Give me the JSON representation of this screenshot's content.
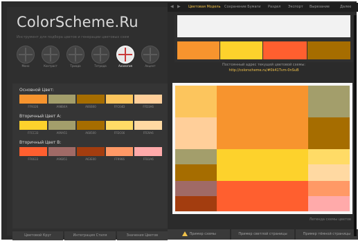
{
  "app": {
    "logo": "ColorScheme.Ru",
    "tagline": "Инструмент для подбора цветов и генерации цветовых схем"
  },
  "schemes": [
    {
      "label": "Моно",
      "active": false
    },
    {
      "label": "Контраст",
      "active": false
    },
    {
      "label": "Триада",
      "active": false
    },
    {
      "label": "Тетрада",
      "active": false
    },
    {
      "label": "Аналогия",
      "active": true
    },
    {
      "label": "Акцент",
      "active": false
    }
  ],
  "palette": {
    "primary_title": "Основной Цвет:",
    "secondary_a_title": "Вторичный Цвет А:",
    "secondary_b_title": "Вторичный Цвет В:",
    "primary_colors": [
      "#F7942E",
      "#A39E6B",
      "#A66D00",
      "#FCC55D",
      "#FFCF9A"
    ],
    "secondary_a_colors": [
      "#FDD22C",
      "#A39E6B",
      "#A66D00",
      "#FFDB66",
      "#FFD9A2"
    ],
    "secondary_b_colors": [
      "#FF5F2F",
      "#A06A66",
      "#A33D0F",
      "#FF9966",
      "#FFAAAA"
    ],
    "primary_codes": [
      "FF9326",
      "A98B4A",
      "A66B00",
      "FFC64D",
      "FFD3A6"
    ],
    "secondary_a_codes": [
      "FFCC33",
      "A99A51",
      "A68500",
      "FFDC66",
      "FFE9A6"
    ],
    "secondary_b_codes": [
      "FF6633",
      "A96B51",
      "A63E00",
      "FF9966",
      "FFB3A6"
    ]
  },
  "tabs_bottom_left": [
    "Цветовой Круг",
    "Интеграция Стиля",
    "Значения Цветов"
  ],
  "nav": {
    "items": [
      "Цветовая Модель",
      "Сохранение Бумаги",
      "Раздел",
      "Экспорт",
      "Вырезание",
      "Далее"
    ],
    "active_index": 0
  },
  "preview": {
    "top_swatches": [
      "#F7942E",
      "#FDD22C",
      "#FF5F2F",
      "#A66D00"
    ],
    "link_text": "Постоянный адрес текущей цветовой схемы:",
    "link_url": "http://colorscheme.ru/#0k41Tvm-0nSuB",
    "legend": "Легенда схемы цветов"
  },
  "tabs_bottom_right": [
    "Пример схемы",
    "Пример светлой страницы",
    "Пример тёмной страницы"
  ],
  "colors": {
    "frame": "#2b2b2b",
    "panel": "#2f2f2f",
    "accent": "#f1c24a"
  }
}
